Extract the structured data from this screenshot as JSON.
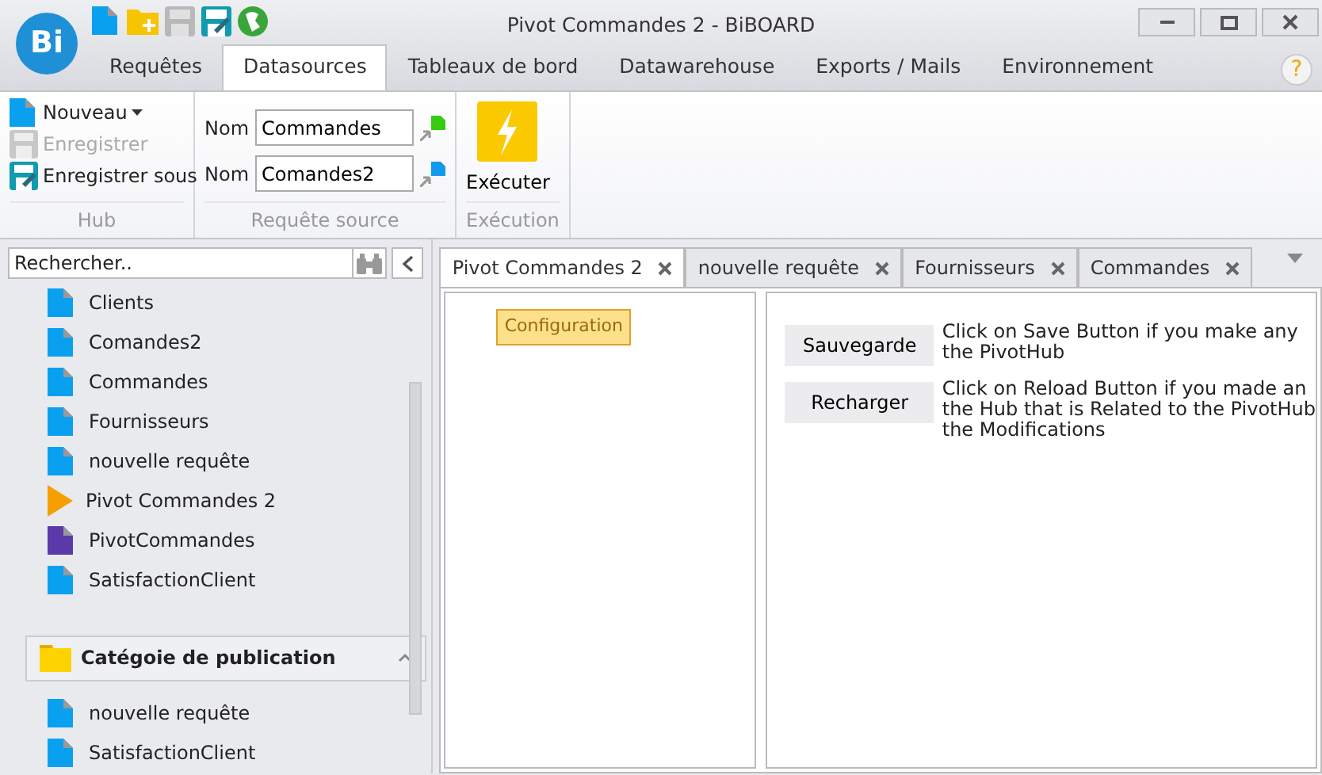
{
  "window": {
    "title": "Pivot Commandes 2 - BiBOARD",
    "app_logo": "Bi"
  },
  "ribbon_tabs": [
    {
      "label": "Requêtes",
      "selected": false
    },
    {
      "label": "Datasources",
      "selected": true
    },
    {
      "label": "Tableaux de bord",
      "selected": false
    },
    {
      "label": "Datawarehouse",
      "selected": false
    },
    {
      "label": "Exports / Mails",
      "selected": false
    },
    {
      "label": "Environnement",
      "selected": false
    }
  ],
  "help": "?",
  "ribbon_groups": [
    {
      "title": "Hub",
      "kind": "buttons",
      "buttons": [
        {
          "label": "Nouveau",
          "dropdown": true,
          "disabled": false
        },
        {
          "label": "Enregistrer",
          "dropdown": false,
          "disabled": true
        },
        {
          "label": "Enregistrer sous",
          "dropdown": false,
          "disabled": false
        }
      ]
    },
    {
      "title": "Requête source",
      "kind": "fields",
      "fields": [
        {
          "label": "Nom",
          "value": "Commandes",
          "color": "#33cc11"
        },
        {
          "label": "Nom",
          "value": "Comandes2",
          "color": "#1199ee"
        }
      ]
    },
    {
      "title": "Exécution",
      "kind": "big",
      "buttons": [
        {
          "label": "Exécuter"
        }
      ]
    }
  ],
  "sidebar": {
    "search": {
      "placeholder": "Rechercher.."
    },
    "items": [
      {
        "label": "Clients",
        "kind": "doc",
        "color": "#0aa0f0"
      },
      {
        "label": "Comandes2",
        "kind": "doc",
        "color": "#0aa0f0"
      },
      {
        "label": "Commandes",
        "kind": "doc",
        "color": "#0aa0f0"
      },
      {
        "label": "Fournisseurs",
        "kind": "doc",
        "color": "#0aa0f0"
      },
      {
        "label": "nouvelle requête",
        "kind": "doc",
        "color": "#0aa0f0"
      },
      {
        "label": "Pivot Commandes 2",
        "kind": "pivot",
        "color": "#f5a000"
      },
      {
        "label": "PivotCommandes",
        "kind": "doc",
        "color": "#5a3aa8"
      },
      {
        "label": "SatisfactionClient",
        "kind": "doc",
        "color": "#0aa0f0"
      }
    ],
    "category": {
      "title": "Catégoie de publication",
      "expanded": true,
      "items": [
        {
          "label": "nouvelle requête",
          "kind": "doc",
          "color": "#0aa0f0"
        },
        {
          "label": "SatisfactionClient",
          "kind": "doc",
          "color": "#0aa0f0"
        }
      ]
    }
  },
  "doc_tabs": [
    {
      "label": "Pivot Commandes 2",
      "selected": true
    },
    {
      "label": "nouvelle requête",
      "selected": false
    },
    {
      "label": "Fournisseurs",
      "selected": false
    },
    {
      "label": "Commandes",
      "selected": false
    }
  ],
  "config_button": "Configuration",
  "actions": [
    {
      "button": "Sauvegarde",
      "lines": [
        "Click on Save Button if you make any",
        "the PivotHub"
      ]
    },
    {
      "button": "Recharger",
      "lines": [
        "Click on Reload Button if you made an",
        "the Hub that is Related to the PivotHub",
        "the Modifications"
      ]
    }
  ]
}
